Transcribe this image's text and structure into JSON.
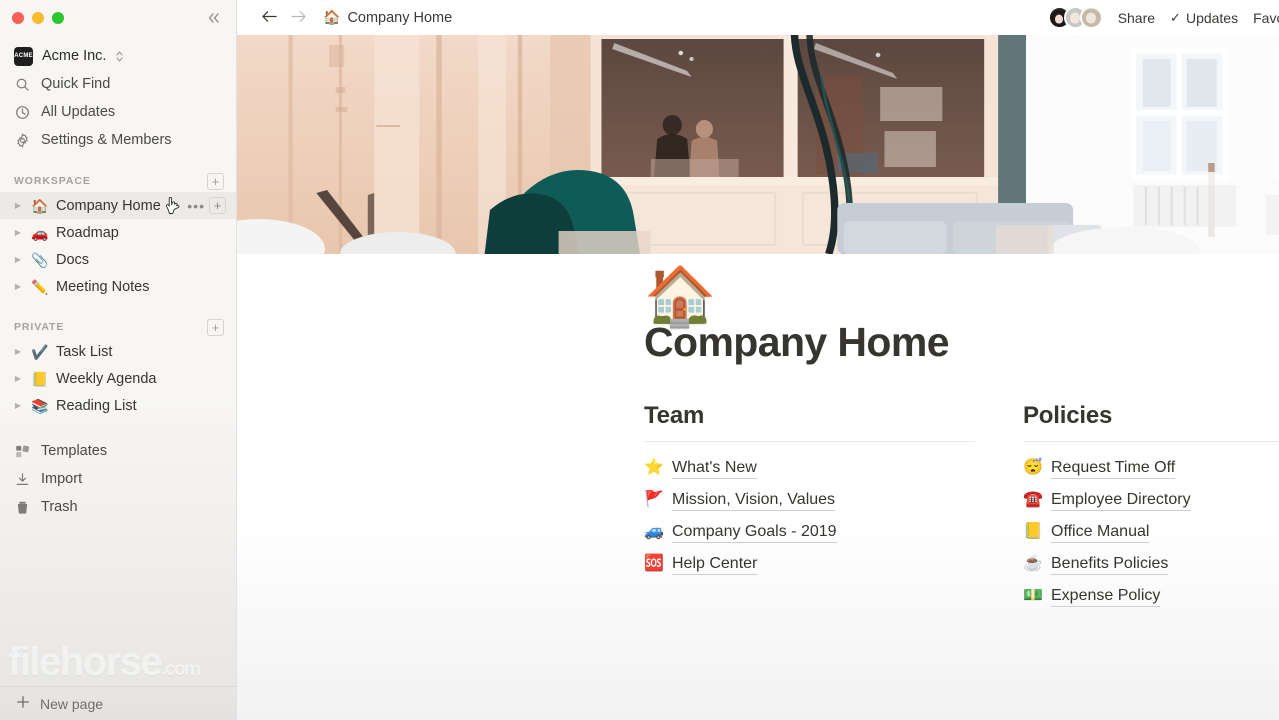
{
  "window": {
    "traffic_lights": [
      "close",
      "minimize",
      "maximize"
    ],
    "collapse_icon": "chevrons-left-icon"
  },
  "sidebar": {
    "workspace_switcher": {
      "logo_text": "ACME",
      "name": "Acme Inc.",
      "caret": "⌃⌄"
    },
    "nav": [
      {
        "label": "Quick Find",
        "icon": "search-icon"
      },
      {
        "label": "All Updates",
        "icon": "clock-icon"
      },
      {
        "label": "Settings & Members",
        "icon": "gear-icon"
      }
    ],
    "sections": [
      {
        "title": "WORKSPACE",
        "add_label": "+",
        "items": [
          {
            "label": "Company Home",
            "emoji": "🏠",
            "hovered": true,
            "dots": "•••",
            "plus": "+"
          },
          {
            "label": "Roadmap",
            "emoji": "🚗",
            "hovered": false
          },
          {
            "label": "Docs",
            "emoji": "📎",
            "hovered": false
          },
          {
            "label": "Meeting Notes",
            "emoji": "✏️",
            "hovered": false
          }
        ]
      },
      {
        "title": "PRIVATE",
        "add_label": "+",
        "items": [
          {
            "label": "Task List",
            "emoji": "✔️",
            "hovered": false
          },
          {
            "label": "Weekly Agenda",
            "emoji": "📒",
            "hovered": false
          },
          {
            "label": "Reading List",
            "emoji": "📚",
            "hovered": false
          }
        ]
      }
    ],
    "bottom_nav": [
      {
        "label": "Templates",
        "icon": "templates-icon"
      },
      {
        "label": "Import",
        "icon": "import-download-icon"
      },
      {
        "label": "Trash",
        "icon": "trash-icon"
      }
    ],
    "watermark": {
      "name": "filehorse",
      "tld": ".com"
    },
    "new_page": {
      "label": "New page",
      "icon": "plus-icon"
    }
  },
  "topbar": {
    "back_icon": "arrow-left-icon",
    "forward_icon": "arrow-right-icon",
    "breadcrumb": {
      "emoji": "🏠",
      "label": "Company Home"
    },
    "share_label": "Share",
    "updates_label": "Updates",
    "updates_check": "✓",
    "favorite_label": "Favorite",
    "more_label": "•••",
    "collaborators": [
      "avatar-1",
      "avatar-2",
      "avatar-3"
    ]
  },
  "page": {
    "cover_alt": "office-interior-cover-photo",
    "icon_emoji": "🏠",
    "title": "Company Home",
    "columns": [
      {
        "heading": "Team",
        "links": [
          {
            "emoji": "⭐",
            "label": "What's New"
          },
          {
            "emoji": "🚩",
            "label": "Mission, Vision, Values"
          },
          {
            "emoji": "🚙",
            "label": "Company Goals - 2019"
          },
          {
            "emoji": "🆘",
            "label": "Help Center"
          }
        ]
      },
      {
        "heading": "Policies",
        "links": [
          {
            "emoji": "😴",
            "label": "Request Time Off"
          },
          {
            "emoji": "☎️",
            "label": "Employee Directory"
          },
          {
            "emoji": "📒",
            "label": "Office Manual"
          },
          {
            "emoji": "☕",
            "label": "Benefits Policies"
          },
          {
            "emoji": "💵",
            "label": "Expense Policy"
          }
        ]
      }
    ]
  },
  "help_button": {
    "label": "?"
  },
  "colors": {
    "sidebar_bg": "#f7f6f3",
    "text_primary": "#37352f",
    "text_muted": "#a6a29c",
    "rule": "#e9e9e7",
    "light_red": "#fa5e57",
    "light_yellow": "#f6bc2f",
    "light_green": "#2ac630"
  }
}
